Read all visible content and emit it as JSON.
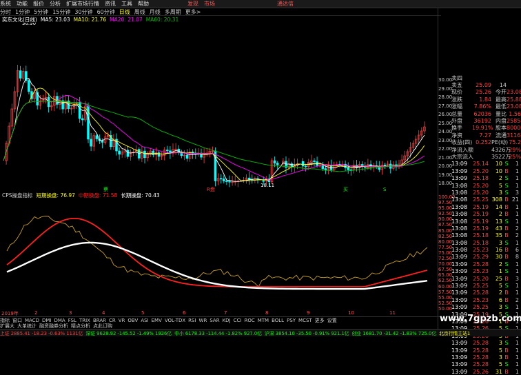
{
  "menu": {
    "items": [
      "系统",
      "功能",
      "报价",
      "分析",
      "扩展市场行情",
      "资讯",
      "工具",
      "帮助"
    ],
    "center": [
      "发现",
      "市场"
    ],
    "right": "通达信"
  },
  "periods": [
    "分时",
    "1分钟",
    "5分钟",
    "15分钟",
    "30分钟",
    "60分钟",
    "日线",
    "周线",
    "月线",
    "多周期",
    "更多>"
  ],
  "active_period": "日线",
  "ma_legend": {
    "stock": "奕东文化(日线)",
    "ma5": "MA5: 23.03",
    "ma10": "MA10: 21.76",
    "ma20": "MA20: 21.07",
    "ma60": "MA60: 20.31"
  },
  "price_high_label": "36.90",
  "price_low_label": "18.11",
  "ind_legend": {
    "name": "CPS操盘指标",
    "short": "短期操盘: 76.97",
    "mid": "中期操盘: 71.58",
    "long": "长期操盘: 70.43"
  },
  "colors": {
    "up": "#ff4040",
    "down": "#00ffff",
    "ma5": "#ffffff",
    "ma10": "#ffff00",
    "ma20": "#ff00ff",
    "ma60": "#00c000",
    "ind_short": "#c8a020",
    "ind_mid": "#ff2020",
    "ind_long": "#ffffff"
  },
  "price_axis": [
    "30.00",
    "29.00",
    "28.00",
    "27.00",
    "26.00",
    "25.00",
    "24.00",
    "23.00",
    "22.00",
    "21.00",
    "20.00",
    "19.00",
    "18.00"
  ],
  "ind_axis": [
    "100.00",
    "97.50",
    "95.00",
    "92.50",
    "90.00",
    "87.50",
    "85.00",
    "82.50",
    "80.00",
    "77.50",
    "75.00",
    "72.50",
    "70.00",
    "67.50",
    "65.00",
    "62.50",
    "60.00",
    "57.50",
    "55.00",
    "52.50",
    "50.00"
  ],
  "events": [
    "蔡",
    "R盘",
    "买",
    "S"
  ],
  "quote": {
    "rows": [
      {
        "l": "卖四",
        "v": "",
        "l2": "",
        "v2": ""
      },
      {
        "l": "卖五",
        "v": "25.09",
        "l2": "14",
        "v2": ""
      },
      {
        "l": "现价",
        "v": "25.26",
        "l2": "今开",
        "v2": "23.08"
      },
      {
        "l": "涨跌",
        "v": "1.84",
        "l2": "最高",
        "v2": "25.88"
      },
      {
        "l": "涨幅",
        "v": "7.86%",
        "l2": "最低",
        "v2": "23.08"
      },
      {
        "l": "总量",
        "v": "62036",
        "l2": "量比",
        "v2": "1.56"
      },
      {
        "l": "外盘",
        "v": "36192",
        "l2": "内盘",
        "v2": "25854"
      },
      {
        "l": "换手",
        "v": "19.91%",
        "l2": "股本",
        "v2": "8000万"
      },
      {
        "l": "净资",
        "v": "7.27",
        "l2": "流通",
        "v2": "3116万"
      },
      {
        "l": "收益(四)",
        "v": "0.252",
        "l2": "PE(动)",
        "v2": "75.2"
      },
      {
        "l": "净流入额",
        "v": "",
        "l2": "4326万",
        "v2": "29%"
      },
      {
        "l": "大宗流入",
        "v": "",
        "l2": "3522万",
        "v2": "25%"
      }
    ]
  },
  "ticks": [
    {
      "t": "13:09",
      "p": "25.14",
      "v": "10",
      "d": "S",
      "n": "1"
    },
    {
      "t": "13:09",
      "p": "25.20",
      "v": "10",
      "d": "B",
      "n": "1"
    },
    {
      "t": "13:09",
      "p": "25.18",
      "v": "2",
      "d": "S",
      "n": "1"
    },
    {
      "t": "13:08",
      "p": "25.20",
      "v": "5",
      "d": "S",
      "n": "1"
    },
    {
      "t": "13:08",
      "p": "25.20",
      "v": "3",
      "d": "S",
      "n": "3"
    },
    {
      "t": "13:08",
      "p": "25.25",
      "v": "308",
      "d": "B",
      "n": "21"
    },
    {
      "t": "13:08",
      "p": "25.19",
      "v": "14",
      "d": "B",
      "n": "1"
    },
    {
      "t": "13:08",
      "p": "25.19",
      "v": "2",
      "d": "B",
      "n": "1"
    },
    {
      "t": "13:08",
      "p": "25.19",
      "v": "13",
      "d": "S",
      "n": "1"
    },
    {
      "t": "13:08",
      "p": "25.19",
      "v": "43",
      "d": "B",
      "n": "2"
    },
    {
      "t": "13:08",
      "p": "25.18",
      "v": "35",
      "d": "B",
      "n": "2"
    },
    {
      "t": "13:08",
      "p": "25.18",
      "v": "3",
      "d": "S",
      "n": "1"
    },
    {
      "t": "13:08",
      "p": "25.23",
      "v": "16",
      "d": "B",
      "n": "6"
    },
    {
      "t": "13:09",
      "p": "25.29",
      "v": "30",
      "d": "B",
      "n": "8"
    },
    {
      "t": "13:09",
      "p": "25.28",
      "v": "2",
      "d": "S",
      "n": "1"
    },
    {
      "t": "13:09",
      "p": "25.23",
      "v": "1",
      "d": "S",
      "n": "1"
    },
    {
      "t": "13:09",
      "p": "25.20",
      "v": "25",
      "d": "B",
      "n": "3"
    },
    {
      "t": "13:09",
      "p": "25.25",
      "v": "5",
      "d": "S",
      "n": "1"
    },
    {
      "t": "13:09",
      "p": "25.28",
      "v": "2",
      "d": "B",
      "n": "1"
    },
    {
      "t": "13:09",
      "p": "25.23",
      "v": "6",
      "d": "B",
      "n": "2"
    },
    {
      "t": "13:09",
      "p": "25.25",
      "v": "3",
      "d": "S",
      "n": "1"
    },
    {
      "t": "13:09",
      "p": "25.19",
      "v": "5",
      "d": "S",
      "n": "1"
    },
    {
      "t": "13:09",
      "p": "25.26",
      "v": "1",
      "d": "B",
      "n": "1"
    },
    {
      "t": "13:09",
      "p": "25.26",
      "v": "5",
      "d": "S",
      "n": "1"
    },
    {
      "t": "13:09",
      "p": "25.26",
      "v": "3",
      "d": "B",
      "n": "1"
    },
    {
      "t": "13:09",
      "p": "25.28",
      "v": "3",
      "d": "S",
      "n": "1"
    },
    {
      "t": "13:09",
      "p": "25.28",
      "v": "5",
      "d": "B",
      "n": "1"
    },
    {
      "t": "13:09",
      "p": "25.28",
      "v": "3",
      "d": "B",
      "n": "1"
    },
    {
      "t": "13:09",
      "p": "25.28",
      "v": "5",
      "d": "S",
      "n": "1"
    },
    {
      "t": "13:09",
      "p": "25.26",
      "v": "31",
      "d": "B",
      "n": "1"
    }
  ],
  "xaxis": [
    "2019年",
    "2",
    "3",
    "4",
    "5",
    "6",
    "7",
    "8",
    "9",
    "10",
    "11"
  ],
  "tabs1": [
    "指标",
    "窗口",
    "MACD",
    "DMI",
    "DMA",
    "FSL",
    "TRIX",
    "BRAR",
    "CR",
    "VR",
    "OBV",
    "ASI",
    "EMV",
    "VOL-TDX",
    "RSI",
    "WR",
    "SAR",
    "KDJ",
    "CCI",
    "ROC",
    "MTM",
    "BOLL",
    "PSY",
    "MCST",
    "更多",
    "设置"
  ],
  "tabs2": [
    "扩展大",
    "大单统计",
    "融资融券分析",
    "精点分析",
    "点此订购"
  ],
  "status": [
    {
      "t": "上证 2885.41 -18.23 -0.63% 1131亿",
      "c": "#ff4040"
    },
    {
      "t": "深证 9628.92 -145.52 -1.49% 1926亿",
      "c": "#00ff00"
    },
    {
      "t": "中小 6178.33 -114.44 -1.82% 927.0亿",
      "c": "#00ff00"
    },
    {
      "t": "沪深 3854.10 -35.50 -0.91% 921.1亿",
      "c": "#00ff00"
    },
    {
      "t": "创业 1681.70 -31.42 -1.83% 725.0亿",
      "c": "#00ff00"
    },
    {
      "t": "北京行情主站1",
      "c": "#ffff00"
    }
  ],
  "watermark": "www.7gpzb.com",
  "chart_data": [
    {
      "type": "candlestick",
      "title": "奕东文化(日线)",
      "series": [
        {
          "name": "MA5",
          "values": [
            23.03
          ]
        },
        {
          "name": "MA10",
          "values": [
            21.76
          ]
        },
        {
          "name": "MA20",
          "values": [
            21.07
          ]
        },
        {
          "name": "MA60",
          "values": [
            20.31
          ]
        }
      ],
      "ylim": [
        18.0,
        30.0
      ],
      "high_label": 36.9,
      "low_label": 18.11
    },
    {
      "type": "line",
      "title": "CPS操盘指标",
      "series": [
        {
          "name": "短期操盘",
          "values": [
            76.97
          ]
        },
        {
          "name": "中期操盘",
          "values": [
            71.58
          ]
        },
        {
          "name": "长期操盘",
          "values": [
            70.43
          ]
        }
      ],
      "ylim": [
        50.0,
        100.0
      ]
    }
  ]
}
